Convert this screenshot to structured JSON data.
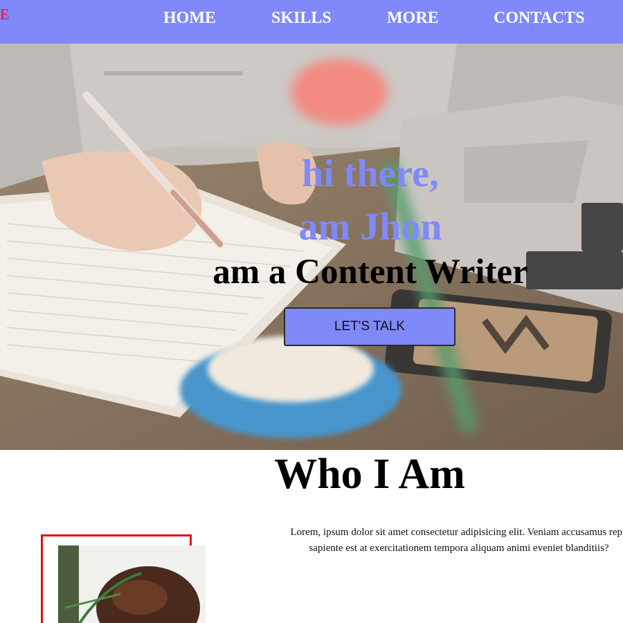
{
  "logo": {
    "text": "E",
    "color": "#e0102e"
  },
  "nav": {
    "background": "#8089fa",
    "items": [
      {
        "label": "HOME"
      },
      {
        "label": "SKILLS"
      },
      {
        "label": "MORE"
      },
      {
        "label": "CONTACTS"
      }
    ]
  },
  "hero": {
    "greeting_line1": "hi there,",
    "greeting_line2": "am Jhon",
    "role": "am a Content Writer",
    "cta_label": "LET'S TALK",
    "accent_color": "#8089fa",
    "background_image": "desk-writing-photo"
  },
  "about": {
    "title": "Who I Am",
    "text_line1": "Lorem, ipsum dolor sit amet consectetur adipisicing elit. Veniam accusamus repu",
    "text_line2": "sapiente est at exercitationem tempora aliquam animi eveniet blanditiis?",
    "frame_color": "#e01010",
    "profile_image": "profile-photo"
  }
}
